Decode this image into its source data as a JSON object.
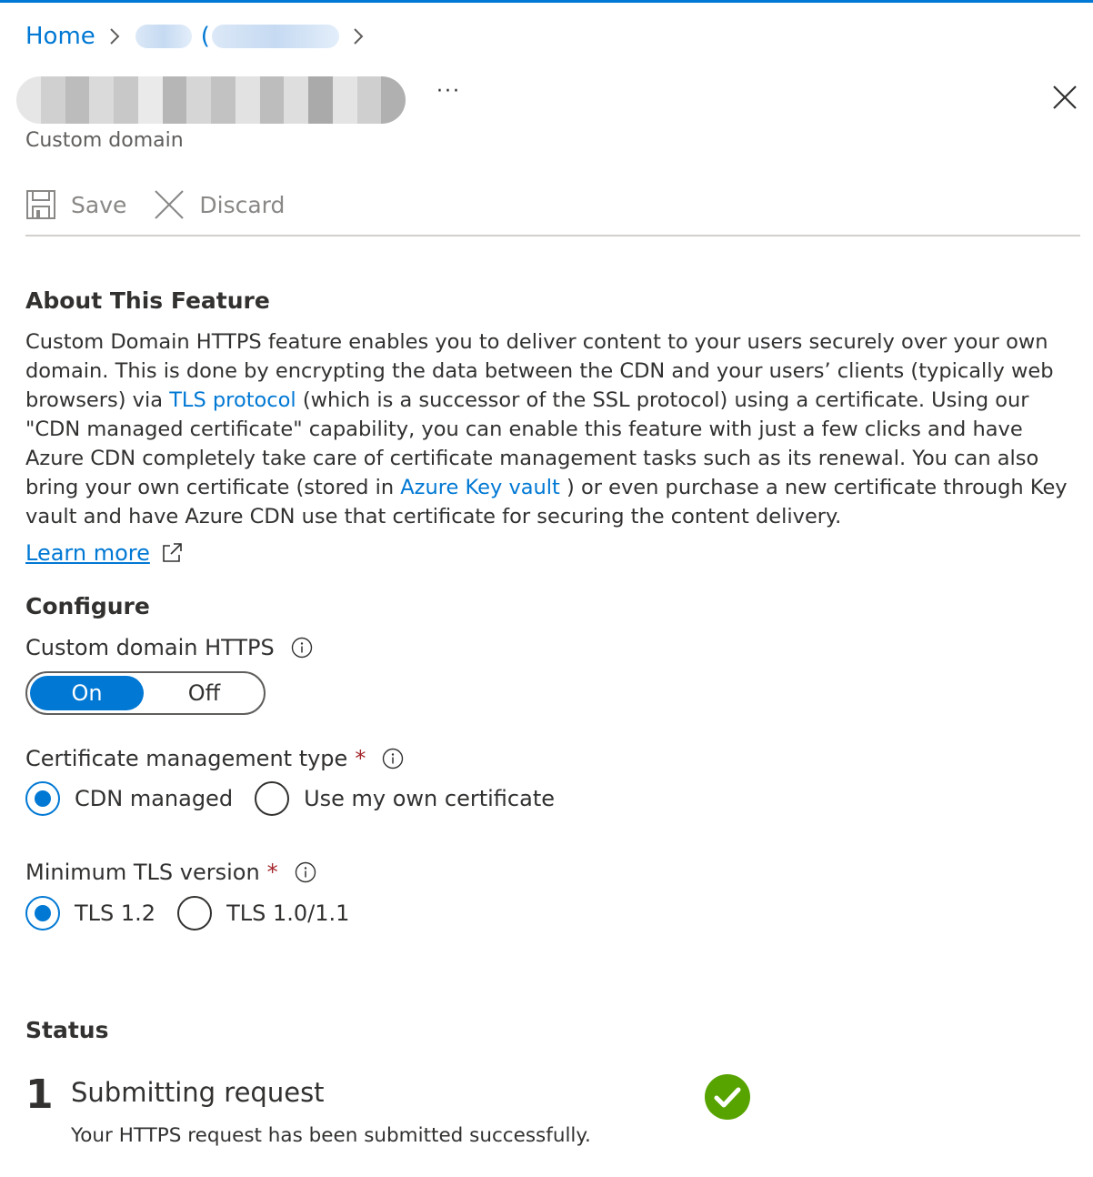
{
  "breadcrumb": {
    "home": "Home",
    "paren": "("
  },
  "header": {
    "subtitle": "Custom domain",
    "more": "···"
  },
  "toolbar": {
    "save_label": "Save",
    "discard_label": "Discard"
  },
  "about": {
    "heading": "About This Feature",
    "text_1": "Custom Domain HTTPS feature enables you to deliver content to your users securely over your own domain. This is done by encrypting the data between the CDN and your users’ clients (typically web browsers) via ",
    "tls_link": "TLS protocol",
    "text_2": " (which is a successor of the SSL protocol) using a certificate. Using our \"CDN managed certificate\" capability, you can enable this feature with just a few clicks and have Azure CDN completely take care of certificate management tasks such as its renewal. You can also bring your own certificate (stored in ",
    "keyvault_link": "Azure Key vault",
    "text_3": " ) or even purchase a new certificate through Key vault and have Azure CDN use that certificate for securing the content delivery.",
    "learn_more": "Learn more"
  },
  "configure": {
    "heading": "Configure",
    "https_label": "Custom domain HTTPS",
    "toggle_on": "On",
    "toggle_off": "Off",
    "cert_label": "Certificate management type",
    "cert_options": [
      "CDN managed",
      "Use my own certificate"
    ],
    "tls_label": "Minimum TLS version",
    "tls_options": [
      "TLS 1.2",
      "TLS 1.0/1.1"
    ],
    "required_mark": "*"
  },
  "status": {
    "heading": "Status",
    "step_number": "1",
    "step_title": "Submitting request",
    "step_desc": "Your HTTPS request has been submitted successfully."
  },
  "colors": {
    "accent": "#0078d4",
    "success": "#57a300",
    "required": "#a4262c"
  }
}
